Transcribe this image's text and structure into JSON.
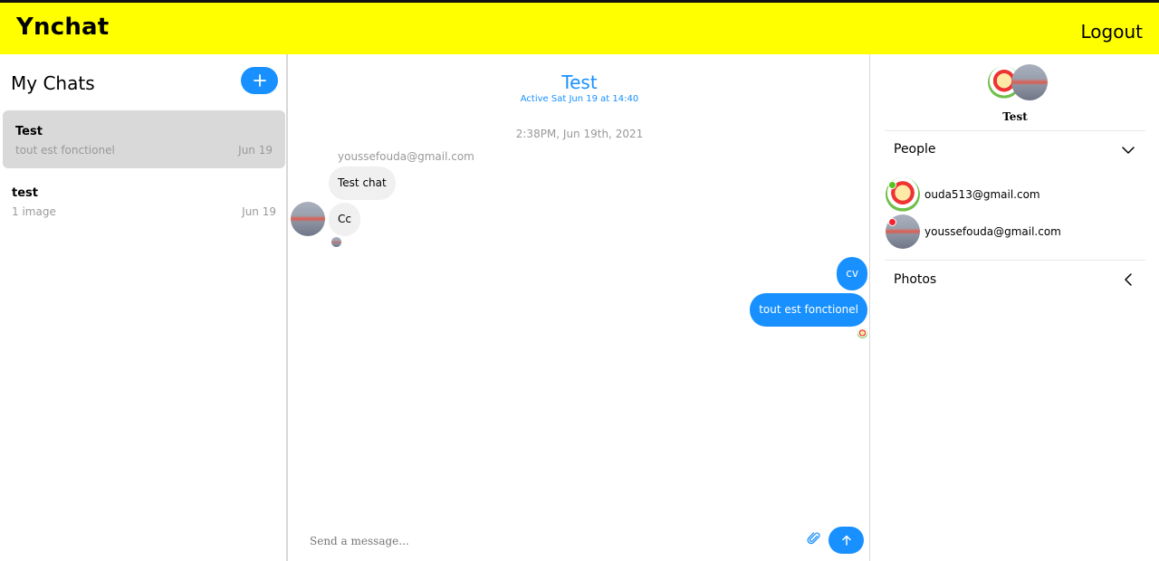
{
  "app": {
    "brand": "Ynchat",
    "logout_label": "Logout"
  },
  "sidebar": {
    "title": "My Chats",
    "new_chat_icon": "plus-icon",
    "chats": [
      {
        "title": "Test",
        "last_message": "tout est fonctionel",
        "date": "Jun 19",
        "active": true
      },
      {
        "title": "test",
        "last_message": "1 image",
        "date": "Jun 19",
        "active": false
      }
    ]
  },
  "conversation": {
    "name": "Test",
    "status": "Active Sat Jun 19 at 14:40",
    "timestamp": "2:38PM, Jun 19th, 2021",
    "sender_email": "youssefouda@gmail.com",
    "incoming": [
      "Test chat",
      "Cc"
    ],
    "outgoing": [
      "cv",
      "tout est fonctionel"
    ],
    "composer_placeholder": "Send a message...",
    "attach_icon": "paperclip-icon",
    "send_icon": "arrow-up-icon"
  },
  "details": {
    "title": "Test",
    "people_label": "People",
    "photos_label": "Photos",
    "people": [
      {
        "email": "ouda513@gmail.com",
        "status_color": "#52c41a"
      },
      {
        "email": "youssefouda@gmail.com",
        "status_color": "#f5222d"
      }
    ]
  },
  "colors": {
    "topbar": "#ffff00",
    "accent": "#1890ff",
    "online": "#52c41a",
    "offline": "#f5222d"
  }
}
